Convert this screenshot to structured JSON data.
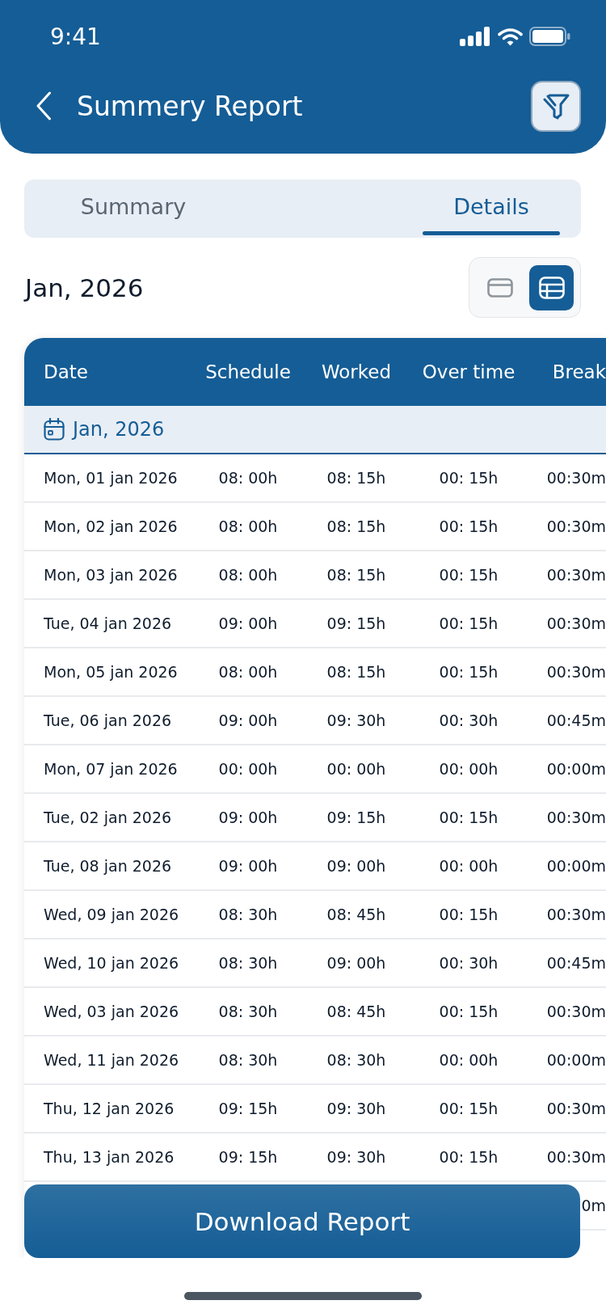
{
  "status_bar": {
    "time": "9:41"
  },
  "header": {
    "title": "Summery Report"
  },
  "tabs": [
    {
      "label": "Summary",
      "selected": false
    },
    {
      "label": "Details",
      "selected": true
    }
  ],
  "period": {
    "label": "Jan, 2026"
  },
  "view_toggle": [
    {
      "kind": "card",
      "selected": false
    },
    {
      "kind": "table",
      "selected": true
    }
  ],
  "table": {
    "columns": [
      "Date",
      "Schedule",
      "Worked",
      "Over time",
      "Break"
    ],
    "groups": [
      {
        "label": "Jan, 2026",
        "rows": [
          {
            "date": "Mon, 01 jan 2026",
            "schedule": "08: 00h",
            "worked": "08: 15h",
            "over_time": "00: 15h",
            "break": "00:30m"
          },
          {
            "date": "Mon, 02 jan 2026",
            "schedule": "08: 00h",
            "worked": "08: 15h",
            "over_time": "00: 15h",
            "break": "00:30m"
          },
          {
            "date": "Mon, 03 jan 2026",
            "schedule": "08: 00h",
            "worked": "08: 15h",
            "over_time": "00: 15h",
            "break": "00:30m"
          },
          {
            "date": "Tue, 04 jan 2026",
            "schedule": "09: 00h",
            "worked": "09: 15h",
            "over_time": "00: 15h",
            "break": "00:30m"
          },
          {
            "date": "Mon, 05 jan 2026",
            "schedule": "08: 00h",
            "worked": "08: 15h",
            "over_time": "00: 15h",
            "break": "00:30m"
          },
          {
            "date": "Tue, 06 jan 2026",
            "schedule": "09: 00h",
            "worked": "09: 30h",
            "over_time": "00: 30h",
            "break": "00:45m"
          },
          {
            "date": "Mon, 07 jan 2026",
            "schedule": "00: 00h",
            "worked": "00: 00h",
            "over_time": "00: 00h",
            "break": "00:00m"
          },
          {
            "date": "Tue, 02 jan 2026",
            "schedule": "09: 00h",
            "worked": "09: 15h",
            "over_time": "00: 15h",
            "break": "00:30m"
          },
          {
            "date": "Tue, 08 jan 2026",
            "schedule": "09: 00h",
            "worked": "09: 00h",
            "over_time": "00: 00h",
            "break": "00:00m"
          },
          {
            "date": "Wed, 09 jan 2026",
            "schedule": "08: 30h",
            "worked": "08: 45h",
            "over_time": "00: 15h",
            "break": "00:30m"
          },
          {
            "date": "Wed, 10 jan 2026",
            "schedule": "08: 30h",
            "worked": "09: 00h",
            "over_time": "00: 30h",
            "break": "00:45m"
          },
          {
            "date": "Wed, 03 jan 2026",
            "schedule": "08: 30h",
            "worked": "08: 45h",
            "over_time": "00: 15h",
            "break": "00:30m"
          },
          {
            "date": "Wed, 11 jan 2026",
            "schedule": "08: 30h",
            "worked": "08: 30h",
            "over_time": "00: 00h",
            "break": "00:00m"
          },
          {
            "date": "Thu, 12 jan 2026",
            "schedule": "09: 15h",
            "worked": "09: 30h",
            "over_time": "00: 15h",
            "break": "00:30m"
          },
          {
            "date": "Thu, 13 jan 2026",
            "schedule": "09: 15h",
            "worked": "09: 30h",
            "over_time": "00: 15h",
            "break": "00:30m"
          },
          {
            "break": "0m"
          }
        ]
      }
    ]
  },
  "download_button": {
    "label": "Download Report"
  }
}
